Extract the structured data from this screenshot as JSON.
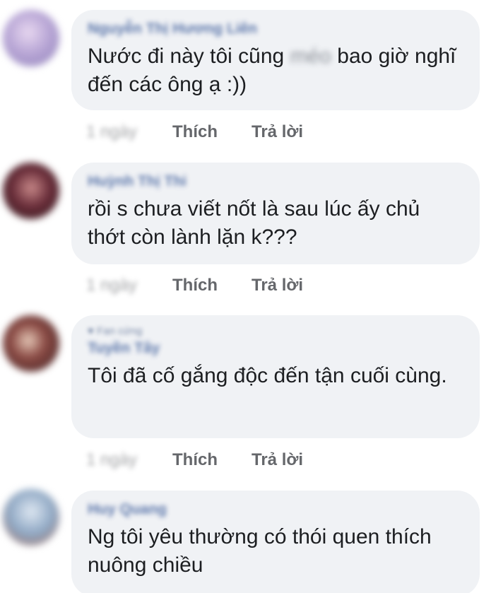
{
  "actions": {
    "like_label": "Thích",
    "reply_label": "Trả lời",
    "time": "1 ngày"
  },
  "comments": [
    {
      "name": "Nguyễn Thị Hương Liên",
      "text_before": "Nước đi này tôi cũng ",
      "text_blurred": "méo",
      "text_after": " bao giờ nghĩ đến các ông ạ :))",
      "avatar_color": "#b9a7d6"
    },
    {
      "name": "Huỳnh Thị Thi",
      "text": "rồi s chưa viết nốt là sau lúc ấy chủ thớt còn lành lặn k???",
      "avatar_color": "#6a2e3a"
    },
    {
      "badge": "Fan cứng",
      "name": "Tuyền Tây",
      "text": "Tôi đã cố gắng độc đến tận cuối cùng.",
      "avatar_color": "#5a3436"
    },
    {
      "name": "Huy Quang",
      "text": "Ng tôi yêu thường có thói quen thích nuông chiều",
      "avatar_color": "#8fa8c4"
    }
  ]
}
